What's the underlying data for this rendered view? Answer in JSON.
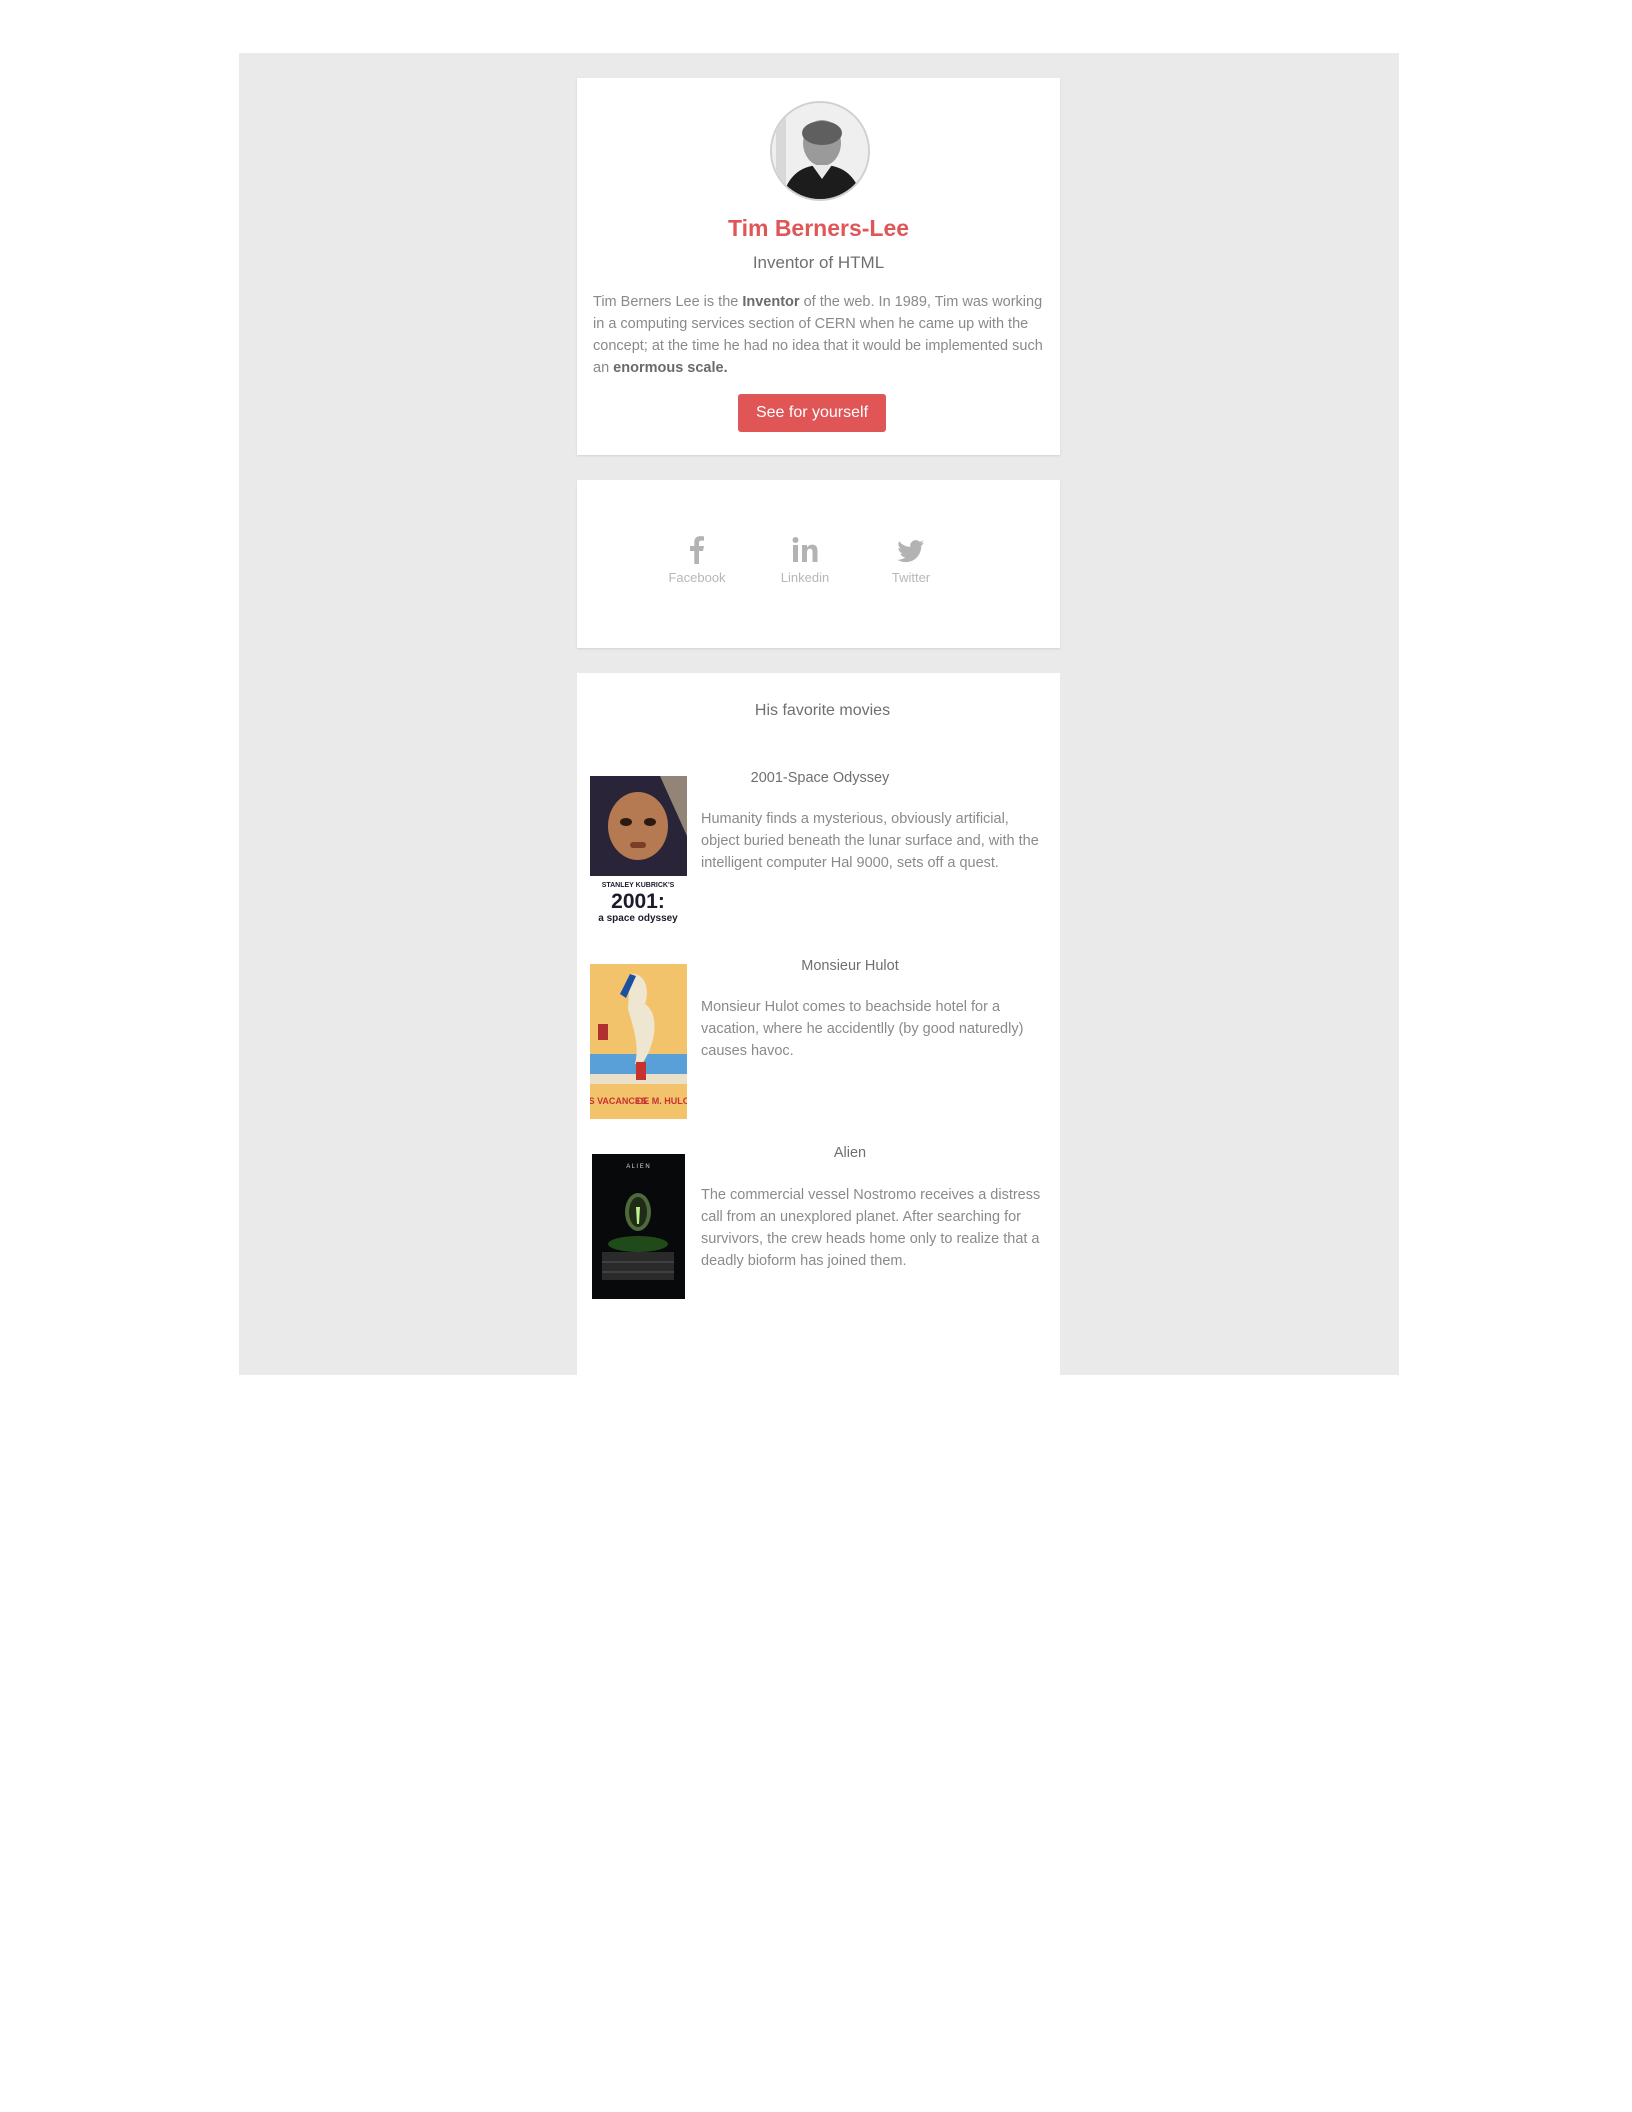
{
  "profile": {
    "name": "Tim Berners-Lee",
    "subtitle": "Inventor of HTML",
    "bio": {
      "part1": "Tim Berners Lee is the ",
      "bold1": "Inventor",
      "part2": " of the web. In 1989, Tim was working in a computing services section of CERN when he came up with the concept; at the time he had no idea that it would be implemented such an ",
      "bold2": "enormous scale."
    },
    "cta_label": "See for yourself",
    "accent_color": "#e05657"
  },
  "social": {
    "items": [
      {
        "label": "Facebook",
        "icon": "facebook-icon"
      },
      {
        "label": "Linkedin",
        "icon": "linkedin-icon"
      },
      {
        "label": "Twitter",
        "icon": "twitter-icon"
      }
    ]
  },
  "movies": {
    "heading": "His favorite movies",
    "items": [
      {
        "title": "2001-Space Odyssey",
        "description": "Humanity finds a mysterious, obviously artificial, object buried beneath the lunar surface and, with the intelligent computer Hal 9000, sets off a quest.",
        "poster_credit": "STANLEY KUBRICK'S",
        "poster_title": "2001:",
        "poster_subtitle": "a space odyssey"
      },
      {
        "title": "Monsieur Hulot",
        "description": "Monsieur Hulot comes to beachside hotel for a vacation, where he accidentlly (by good naturedly) causes havoc.",
        "poster_text_left": "LES VACANCES",
        "poster_text_right": "DE M. HULOT"
      },
      {
        "title": "Alien",
        "description": "The commercial vessel Nostromo receives a distress call from an unexplored planet. After searching for survivors, the crew heads home only to realize that a deadly bioform has joined them.",
        "poster_title": "A L I E N"
      }
    ]
  }
}
